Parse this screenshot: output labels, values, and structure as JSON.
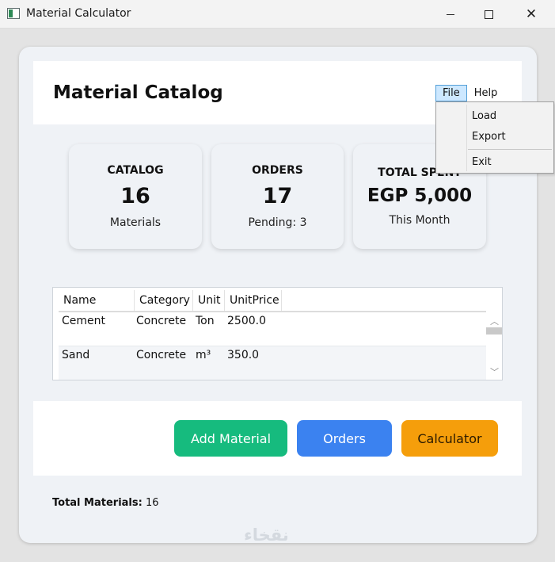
{
  "window": {
    "title": "Material Calculator"
  },
  "header": {
    "title": "Material Catalog"
  },
  "menu": {
    "file": "File",
    "help": "Help",
    "file_items": {
      "load": "Load",
      "export": "Export",
      "exit": "Exit"
    }
  },
  "stats": [
    {
      "label": "CATALOG",
      "value": "16",
      "sub": "Materials"
    },
    {
      "label": "ORDERS",
      "value": "17",
      "sub": "Pending: 3"
    },
    {
      "label": "TOTAL SPENT",
      "value": "EGP 5,000",
      "sub": "This Month"
    }
  ],
  "table": {
    "columns": [
      "Name",
      "Category",
      "Unit",
      "UnitPrice"
    ],
    "rows": [
      [
        "Cement",
        "Concrete",
        "Ton",
        "2500.0"
      ],
      [
        "Sand",
        "Concrete",
        "m³",
        "350.0"
      ]
    ]
  },
  "actions": {
    "add": "Add Material",
    "orders": "Orders",
    "calculator": "Calculator"
  },
  "footer": {
    "total_label": "Total Materials:",
    "total_value": "16"
  },
  "watermark": "نقخاء",
  "colors": {
    "add": "#16bb7e",
    "orders": "#3b82f0",
    "calculator": "#f59e0b"
  }
}
